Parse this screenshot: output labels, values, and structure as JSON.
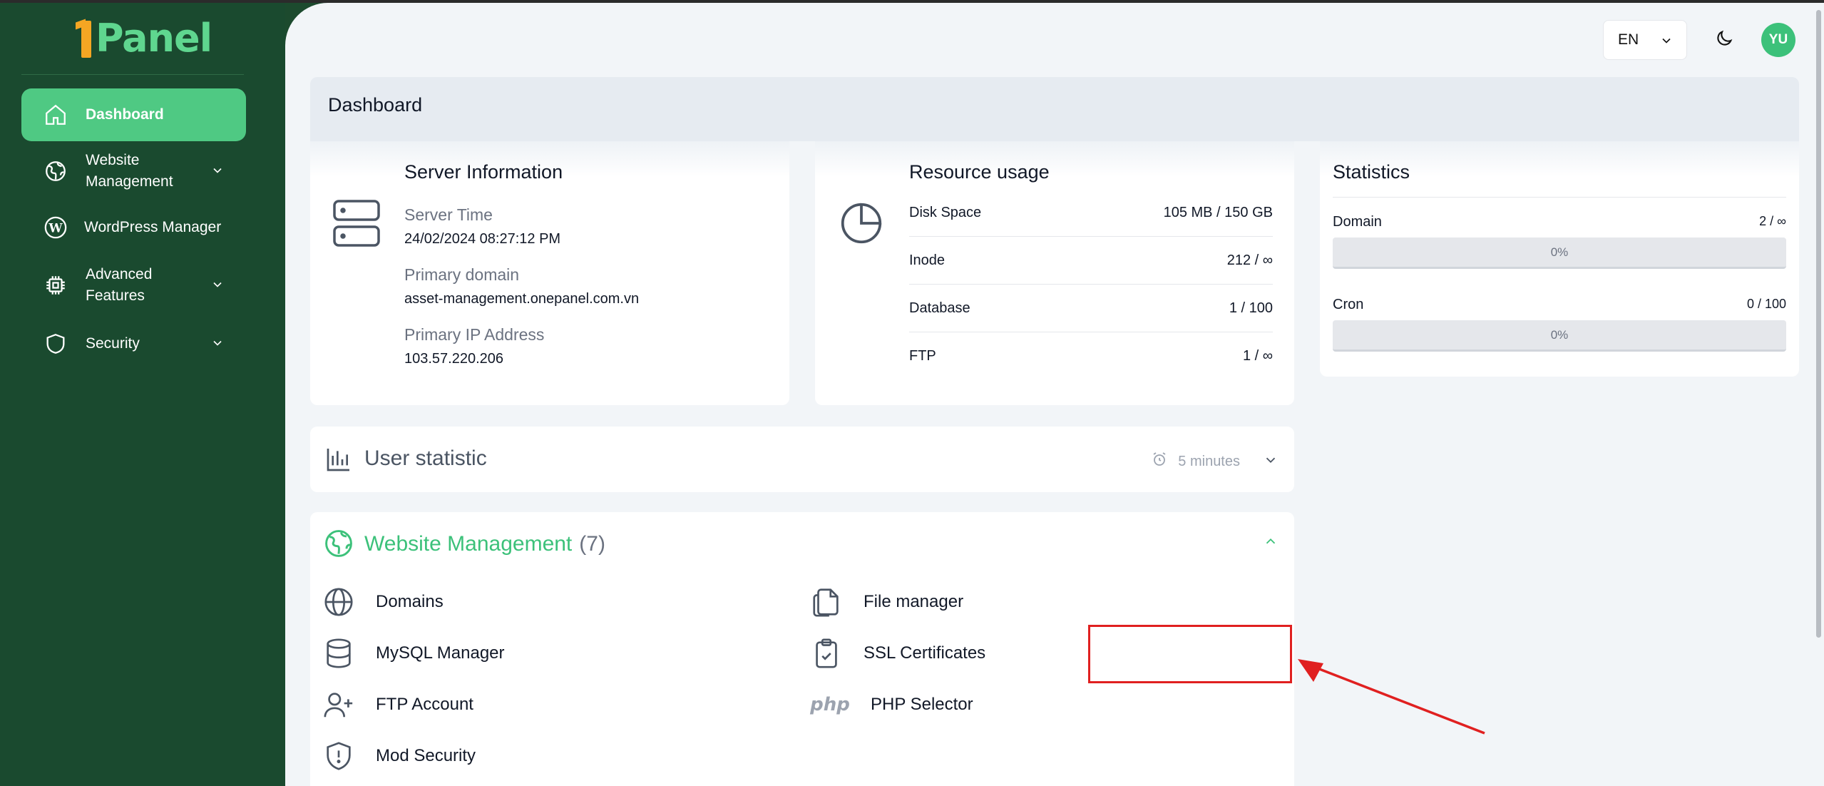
{
  "app": {
    "logo_text": "Panel"
  },
  "sidebar": {
    "items": [
      {
        "label": "Dashboard",
        "icon": "home-icon",
        "active": true
      },
      {
        "label": "Website Management",
        "icon": "globe-leaf-icon",
        "expandable": true
      },
      {
        "label": "WordPress Manager",
        "icon": "wordpress-icon"
      },
      {
        "label": "Advanced Features",
        "icon": "chip-icon",
        "expandable": true
      },
      {
        "label": "Security",
        "icon": "shield-icon",
        "expandable": true
      }
    ]
  },
  "header": {
    "language": "EN",
    "avatar_initials": "YU"
  },
  "page": {
    "title": "Dashboard"
  },
  "server_info": {
    "title": "Server Information",
    "server_time_label": "Server Time",
    "server_time": "24/02/2024 08:27:12 PM",
    "primary_domain_label": "Primary domain",
    "primary_domain": "asset-management.onepanel.com.vn",
    "primary_ip_label": "Primary IP Address",
    "primary_ip": "103.57.220.206"
  },
  "resource_usage": {
    "title": "Resource usage",
    "rows": [
      {
        "label": "Disk Space",
        "value": "105 MB / 150 GB"
      },
      {
        "label": "Inode",
        "value": "212 / ∞"
      },
      {
        "label": "Database",
        "value": "1 / 100"
      },
      {
        "label": "FTP",
        "value": "1 / ∞"
      }
    ]
  },
  "statistics": {
    "title": "Statistics",
    "rows": [
      {
        "label": "Domain",
        "count": "2 / ∞",
        "percent_text": "0%",
        "percent": 0
      },
      {
        "label": "Cron",
        "count": "0 / 100",
        "percent_text": "0%",
        "percent": 0
      }
    ]
  },
  "user_statistic": {
    "title": "User statistic",
    "interval": "5 minutes"
  },
  "website_management": {
    "title": "Website Management",
    "count": "(7)",
    "items": [
      {
        "label": "Domains",
        "icon": "globe-icon"
      },
      {
        "label": "File manager",
        "icon": "files-icon"
      },
      {
        "label": "MySQL Manager",
        "icon": "database-icon"
      },
      {
        "label": "SSL Certificates",
        "icon": "clipboard-check-icon"
      },
      {
        "label": "FTP Account",
        "icon": "user-plus-icon"
      },
      {
        "label": "PHP Selector",
        "icon": "php-icon",
        "icon_text": "php"
      },
      {
        "label": "Mod Security",
        "icon": "shield-alert-icon"
      }
    ]
  },
  "colors": {
    "sidebar": "#1a4a2f",
    "accent": "#3cc17a",
    "annotation": "#e02020"
  }
}
